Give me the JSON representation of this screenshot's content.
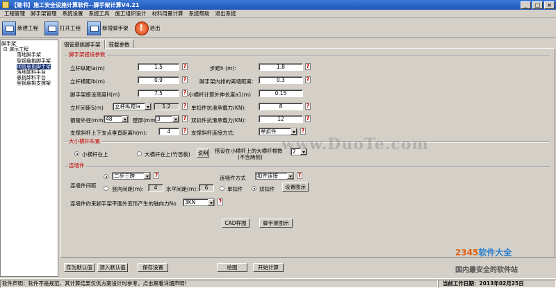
{
  "window": {
    "title": "【建书】施工安全设施计算软件--脚手架计算V4.21"
  },
  "menu": [
    "工程管理",
    "脚手架管理",
    "系统设置",
    "系统工具",
    "施工组织设计",
    "材料用量计算",
    "系统帮助",
    "退出系统"
  ],
  "toolbar": {
    "new_project": "新建工程",
    "open_project": "打开工程",
    "new_scaffold": "新增脚手架",
    "exit": "退出"
  },
  "tree": {
    "root": "脚手架",
    "project": "演示工程",
    "items": [
      "落地脚手架",
      "型钢悬挑脚手架",
      "钢管悬挑脚手架",
      "落地卸料平台",
      "悬挑卸料平台",
      "型钢悬挑支撑架"
    ],
    "selected_index": 2
  },
  "tabs": [
    "钢管悬挑脚手架",
    "荷载参数"
  ],
  "section1": {
    "title": "脚手架搭设参数",
    "la_label": "立杆纵距la(m)",
    "la_value": "1.5",
    "step_label": "步距h (m):",
    "step_value": "1.8",
    "lb_label": "立杆横距lb(m)",
    "lb_value": "0.9",
    "inner_label": "脚手架内排的离墙距离:",
    "inner_value": "0.3",
    "height_label": "脚手架搭设高度H(m)",
    "height_value": "7.5",
    "a1_label": "小横杆计算外伸长度a1(m)",
    "a1_value": "0.15",
    "s_label": "立杆间距S(m)",
    "s_select": "立杆纵距la",
    "s_value": "1.2",
    "single_label": "单扣件抗滑承载力(KN):",
    "single_value": "8",
    "pipe_label": "钢管外径(mm)",
    "pipe_value": "48",
    "wall_label": "壁厚(mm)",
    "wall_value": "3",
    "double_label": "双扣件抗滑承载力(KN):",
    "double_value": "12",
    "brace_dist_label": "支撑斜杆上下支点垂直距离h(m):",
    "brace_dist_value": "4",
    "brace_conn_label": "支撑斜杆连接方式:",
    "brace_conn_value": "单扣件"
  },
  "section2": {
    "title": "大小横杆布置",
    "opt1": "小横杆在上",
    "opt2": "大横杆在上(竹笆板)",
    "explain_btn": "说明",
    "count_label": "搭设在小横杆上的大横杆根数",
    "count_sub": "(不含两侧)",
    "count_value": "2"
  },
  "section3": {
    "title": "连墙件",
    "spacing_label": "连墙件间距",
    "spacing_value": "二步三跨",
    "method_label": "连墙件方式",
    "method_value": "扣件连接",
    "vert_label": "竖向间距(m):",
    "vert_value": "4",
    "horiz_label": "水平间距(m):",
    "horiz_value": "6",
    "single_opt": "单扣件",
    "double_opt": "双扣件",
    "setup_btn": "设置图示",
    "axial_label": "连墙件约束脚手架平面外变形产生的轴向力No",
    "axial_value": "3KN"
  },
  "buttons": {
    "cad": "CAD样图",
    "scaffold_diagram": "脚手架图示",
    "save_default": "存为默认值",
    "load_default": "调入默认值",
    "save_settings": "保存设置",
    "draw": "绘图",
    "start_calc": "开始计算"
  },
  "watermark": "www.DuoTe.com",
  "brand": {
    "line1a": "2345",
    "line1b": "软件大全",
    "line2": "国内最安全的软件站"
  },
  "status": {
    "left": "软件声明：软件不是规范，其计算结果仅供方案设计时参考，点击察看详细声明!",
    "right": "当前工作日期：2013年02月25日"
  }
}
